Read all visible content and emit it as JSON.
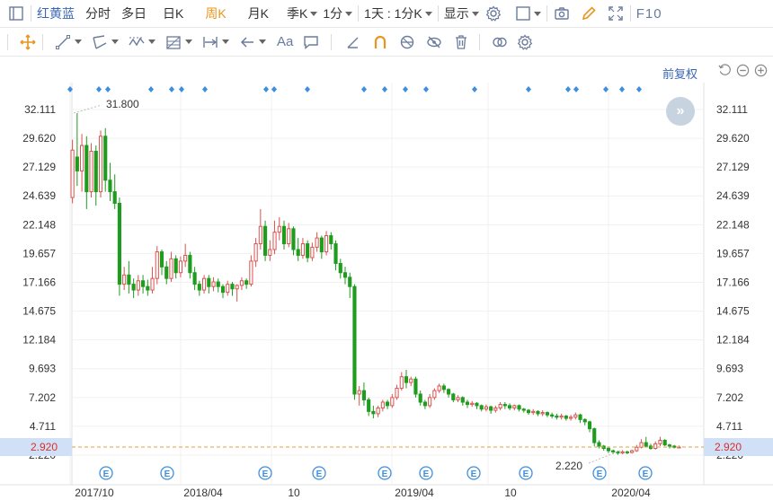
{
  "toolbar": {
    "stock_name": "红黄蓝",
    "tabs": [
      "分时",
      "多日",
      "日K",
      "周K",
      "月K",
      "季K",
      "1分"
    ],
    "active_tab": "周K",
    "range_label": "1天 : 1分K",
    "display_label": "显示",
    "f10_label": "F10"
  },
  "tools": {
    "text_tool_label": "Aa"
  },
  "chart": {
    "adjust_label": "前复权",
    "y_ticks": [
      "32.111",
      "29.620",
      "27.129",
      "24.639",
      "22.148",
      "19.657",
      "17.166",
      "14.675",
      "12.184",
      "9.693",
      "7.202",
      "4.711",
      "2.220"
    ],
    "x_labels": [
      "2017/10",
      "2018/04",
      "10",
      "2019/04",
      "10",
      "2020/04"
    ],
    "current_price": "2.920",
    "max_label": "31.800",
    "min_label": "2.220",
    "event_marker_label": "E",
    "colors": {
      "up": "#d9534f",
      "down": "#1e9c1e",
      "marker": "#3d8fe0",
      "price_line": "#e0a040",
      "price_tag_bg": "#cfe0f7"
    }
  },
  "chart_data": {
    "type": "candlestick",
    "ylim": [
      2.22,
      32.111
    ],
    "x_ticks": [
      "2017/10",
      "2018/04",
      "10",
      "2019/04",
      "10",
      "2020/04"
    ],
    "last_price": 2.92,
    "high_annotation": 31.8,
    "low_annotation": 2.22,
    "ohlc": [
      [
        24.5,
        28.6,
        24.0,
        29.5
      ],
      [
        28.0,
        26.8,
        25.5,
        31.8
      ],
      [
        26.8,
        29.0,
        25.0,
        30.0
      ],
      [
        29.0,
        25.0,
        23.5,
        29.8
      ],
      [
        25.0,
        28.5,
        24.5,
        29.2
      ],
      [
        28.5,
        25.0,
        23.8,
        29.0
      ],
      [
        25.0,
        29.8,
        24.5,
        30.3
      ],
      [
        29.8,
        26.0,
        25.0,
        30.5
      ],
      [
        26.0,
        25.0,
        24.2,
        27.5
      ],
      [
        25.0,
        24.0,
        23.5,
        26.5
      ],
      [
        24.0,
        17.0,
        16.0,
        24.5
      ],
      [
        17.0,
        17.8,
        16.5,
        18.5
      ],
      [
        17.8,
        17.0,
        16.2,
        19.0
      ],
      [
        17.0,
        16.5,
        15.8,
        17.5
      ],
      [
        16.5,
        17.3,
        16.0,
        17.8
      ],
      [
        17.3,
        16.8,
        16.2,
        17.8
      ],
      [
        16.8,
        16.5,
        16.0,
        17.4
      ],
      [
        16.5,
        17.5,
        16.2,
        18.5
      ],
      [
        17.5,
        19.8,
        17.0,
        20.3
      ],
      [
        19.8,
        18.5,
        17.8,
        20.0
      ],
      [
        18.5,
        17.5,
        17.0,
        19.0
      ],
      [
        17.5,
        19.2,
        17.2,
        19.8
      ],
      [
        19.2,
        18.0,
        17.5,
        19.5
      ],
      [
        18.0,
        19.0,
        17.6,
        19.4
      ],
      [
        19.0,
        19.5,
        18.5,
        20.5
      ],
      [
        19.5,
        18.0,
        17.5,
        19.8
      ],
      [
        18.0,
        17.0,
        16.5,
        18.5
      ],
      [
        17.0,
        16.5,
        16.0,
        17.3
      ],
      [
        16.5,
        17.5,
        16.2,
        17.8
      ],
      [
        17.5,
        16.8,
        16.2,
        17.8
      ],
      [
        16.8,
        17.2,
        16.4,
        17.6
      ],
      [
        17.2,
        16.8,
        16.3,
        17.5
      ],
      [
        16.8,
        16.3,
        15.8,
        17.0
      ],
      [
        16.3,
        17.0,
        16.0,
        17.3
      ],
      [
        17.0,
        16.6,
        16.0,
        17.2
      ],
      [
        16.6,
        16.9,
        15.5,
        17.0
      ],
      [
        16.9,
        17.3,
        16.5,
        17.6
      ],
      [
        17.3,
        17.0,
        16.6,
        17.5
      ],
      [
        17.0,
        19.0,
        16.8,
        19.5
      ],
      [
        19.0,
        20.5,
        18.5,
        21.0
      ],
      [
        20.5,
        22.0,
        20.0,
        23.5
      ],
      [
        22.0,
        19.5,
        19.0,
        22.5
      ],
      [
        19.5,
        20.0,
        19.0,
        20.8
      ],
      [
        20.0,
        21.5,
        19.6,
        22.5
      ],
      [
        21.5,
        22.0,
        20.8,
        22.8
      ],
      [
        22.0,
        20.5,
        20.0,
        22.5
      ],
      [
        20.5,
        21.8,
        20.2,
        22.3
      ],
      [
        21.8,
        20.0,
        19.5,
        22.0
      ],
      [
        20.0,
        19.5,
        19.0,
        21.0
      ],
      [
        19.5,
        20.5,
        19.2,
        21.0
      ],
      [
        20.5,
        19.3,
        18.9,
        20.8
      ],
      [
        19.3,
        20.2,
        19.0,
        20.6
      ],
      [
        20.2,
        21.0,
        19.8,
        21.5
      ],
      [
        21.0,
        19.8,
        19.2,
        21.2
      ],
      [
        19.8,
        21.2,
        19.5,
        21.6
      ],
      [
        21.2,
        20.5,
        20.0,
        21.5
      ],
      [
        20.5,
        18.8,
        18.2,
        20.8
      ],
      [
        18.8,
        18.0,
        17.5,
        19.2
      ],
      [
        18.0,
        17.6,
        17.0,
        18.5
      ],
      [
        17.6,
        16.8,
        15.8,
        18.0
      ],
      [
        16.8,
        7.5,
        7.0,
        17.0
      ],
      [
        7.5,
        7.8,
        6.5,
        8.2
      ],
      [
        7.8,
        7.0,
        6.5,
        8.5
      ],
      [
        7.0,
        6.0,
        5.6,
        7.2
      ],
      [
        6.0,
        5.8,
        5.4,
        6.5
      ],
      [
        5.8,
        6.3,
        5.5,
        6.5
      ],
      [
        6.3,
        6.8,
        6.0,
        7.0
      ],
      [
        6.8,
        6.5,
        6.2,
        7.0
      ],
      [
        6.5,
        7.2,
        6.3,
        7.5
      ],
      [
        7.2,
        8.0,
        7.0,
        8.3
      ],
      [
        8.0,
        9.0,
        7.8,
        9.4
      ],
      [
        9.0,
        8.5,
        8.0,
        9.6
      ],
      [
        8.5,
        8.8,
        8.2,
        9.0
      ],
      [
        8.8,
        7.5,
        7.2,
        9.0
      ],
      [
        7.5,
        6.8,
        6.5,
        7.8
      ],
      [
        6.8,
        6.5,
        6.2,
        7.0
      ],
      [
        6.5,
        7.2,
        6.3,
        7.5
      ],
      [
        7.2,
        7.8,
        7.0,
        8.0
      ],
      [
        7.8,
        8.2,
        7.6,
        8.4
      ],
      [
        8.2,
        7.9,
        7.6,
        8.4
      ],
      [
        7.9,
        7.5,
        7.2,
        8.0
      ],
      [
        7.5,
        7.0,
        6.8,
        7.6
      ],
      [
        7.0,
        7.2,
        6.8,
        7.4
      ],
      [
        7.2,
        6.8,
        6.5,
        7.3
      ],
      [
        6.8,
        6.6,
        6.3,
        7.0
      ],
      [
        6.6,
        6.7,
        6.4,
        6.9
      ],
      [
        6.7,
        6.5,
        6.2,
        6.8
      ],
      [
        6.5,
        6.2,
        6.0,
        6.6
      ],
      [
        6.2,
        6.4,
        6.0,
        6.6
      ],
      [
        6.4,
        6.1,
        5.8,
        6.5
      ],
      [
        6.1,
        6.3,
        5.9,
        6.5
      ],
      [
        6.3,
        6.6,
        6.1,
        6.8
      ],
      [
        6.6,
        6.5,
        6.2,
        6.8
      ],
      [
        6.5,
        6.3,
        6.1,
        6.7
      ],
      [
        6.3,
        6.5,
        6.1,
        6.6
      ],
      [
        6.5,
        6.2,
        6.0,
        6.6
      ],
      [
        6.2,
        6.1,
        5.9,
        6.3
      ],
      [
        6.1,
        5.9,
        5.7,
        6.2
      ],
      [
        5.9,
        6.0,
        5.7,
        6.2
      ],
      [
        6.0,
        5.8,
        5.6,
        6.1
      ],
      [
        5.8,
        5.9,
        5.6,
        6.1
      ],
      [
        5.9,
        5.7,
        5.5,
        6.0
      ],
      [
        5.7,
        5.6,
        5.4,
        5.9
      ],
      [
        5.6,
        5.5,
        5.3,
        5.8
      ],
      [
        5.5,
        5.6,
        5.3,
        5.8
      ],
      [
        5.6,
        5.4,
        5.2,
        5.7
      ],
      [
        5.4,
        5.5,
        5.2,
        5.7
      ],
      [
        5.5,
        5.7,
        5.3,
        5.9
      ],
      [
        5.7,
        5.3,
        5.0,
        5.8
      ],
      [
        5.3,
        5.1,
        4.8,
        5.4
      ],
      [
        5.1,
        4.5,
        4.2,
        5.2
      ],
      [
        4.5,
        3.3,
        3.0,
        4.6
      ],
      [
        3.3,
        3.0,
        2.8,
        3.5
      ],
      [
        3.0,
        2.8,
        2.6,
        3.1
      ],
      [
        2.8,
        2.6,
        2.4,
        2.9
      ],
      [
        2.6,
        2.5,
        2.3,
        2.7
      ],
      [
        2.5,
        2.4,
        2.25,
        2.6
      ],
      [
        2.4,
        2.5,
        2.3,
        2.65
      ],
      [
        2.5,
        2.45,
        2.3,
        2.6
      ],
      [
        2.45,
        2.6,
        2.35,
        2.7
      ],
      [
        2.6,
        2.9,
        2.5,
        3.1
      ],
      [
        2.9,
        3.3,
        2.8,
        3.6
      ],
      [
        3.3,
        3.0,
        2.9,
        3.8
      ],
      [
        3.0,
        2.8,
        2.7,
        3.2
      ],
      [
        2.8,
        3.2,
        2.7,
        3.4
      ],
      [
        3.2,
        3.5,
        3.0,
        3.8
      ],
      [
        3.5,
        3.1,
        3.0,
        3.6
      ],
      [
        3.1,
        3.0,
        2.8,
        3.2
      ],
      [
        3.0,
        2.9,
        2.8,
        3.1
      ],
      [
        2.9,
        2.92,
        2.8,
        3.05
      ]
    ]
  }
}
